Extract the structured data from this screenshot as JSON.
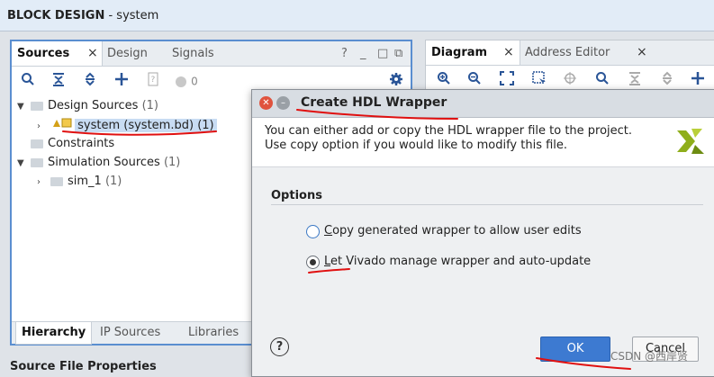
{
  "window": {
    "title_bold": "BLOCK DESIGN",
    "title_rest": " - system"
  },
  "sources_panel": {
    "tabs": [
      "Sources",
      "Design",
      "Signals"
    ],
    "tab_close": "×",
    "controls": [
      "?",
      "_",
      "□",
      "⧉"
    ],
    "toolbar": {
      "count": "0"
    },
    "tree": [
      {
        "label": "Design Sources",
        "count": "(1)"
      },
      {
        "label": "system (system.bd)",
        "count": "(1)"
      },
      {
        "label": "Constraints",
        "count": ""
      },
      {
        "label": "Simulation Sources",
        "count": "(1)"
      },
      {
        "label": "sim_1",
        "count": "(1)"
      }
    ],
    "bottom_tabs": [
      "Hierarchy",
      "IP Sources",
      "Libraries"
    ]
  },
  "source_file_properties": "Source File Properties",
  "diagram_panel": {
    "tabs": [
      "Diagram",
      "Address Editor"
    ],
    "tab_close": "×"
  },
  "dialog": {
    "title": "Create HDL Wrapper",
    "description": "You can either add or copy the HDL wrapper file to the project. Use copy option if you would like to modify this file.",
    "options_title": "Options",
    "option1": {
      "mnemonic": "C",
      "rest": "opy generated wrapper to allow user edits",
      "selected": false
    },
    "option2": {
      "mnemonic": "L",
      "rest": "et Vivado manage wrapper and auto-update",
      "selected": true
    },
    "help": "?",
    "ok": "OK",
    "cancel": "Cancel"
  },
  "watermark": "CSDN @西岸贤",
  "colors": {
    "accent": "#3d7ad1",
    "panel_border": "#5a8ed0",
    "annotation": "#e01010"
  }
}
